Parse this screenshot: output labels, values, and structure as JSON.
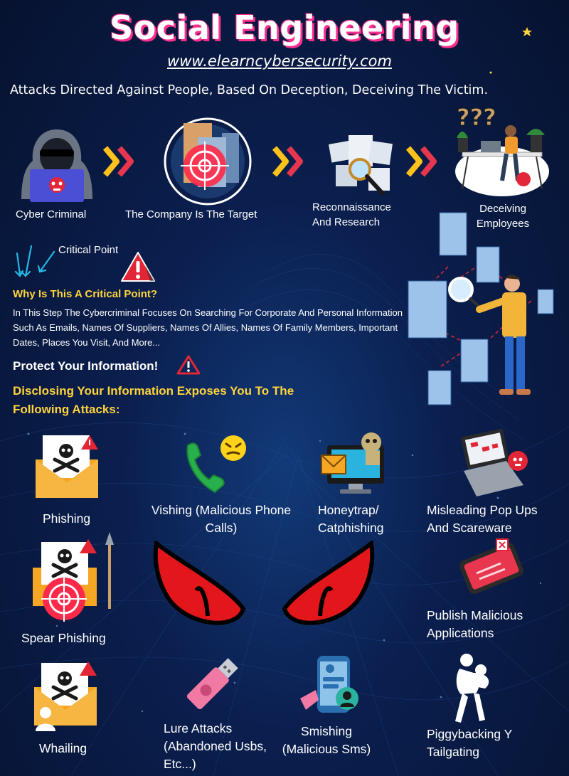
{
  "header": {
    "title": "Social Engineering",
    "url": "www.elearncybersecurity.com",
    "subtitle": "Attacks Directed Against People, Based On Deception, Deceiving The Victim."
  },
  "flow": {
    "steps": [
      {
        "label": "Cyber Criminal",
        "icon": "hooded-hacker-icon"
      },
      {
        "label": "The Company Is The Target",
        "icon": "target-building-icon"
      },
      {
        "label": "Reconnaissance And Research",
        "icon": "magnifier-documents-icon"
      },
      {
        "label": "Deceiving Employees",
        "icon": "confused-employee-icon"
      }
    ],
    "arrow_icon": "double-chevron-icon"
  },
  "critical": {
    "label": "Critical Point",
    "heading": "Why Is This A Critical Point?",
    "body": "In This Step The Cybercriminal Focuses On Searching For Corporate And Personal Information Such As Emails, Names Of Suppliers, Names Of Allies, Names Of Family Members, Important Dates, Places You Visit, And More...",
    "protect": "Protect Your Information!",
    "disclosing": "Disclosing Your Information Exposes You To The Following Attacks:"
  },
  "attacks": {
    "phishing": "Phishing",
    "vishing": "Vishing (Malicious Phone Calls)",
    "honeytrap": "Honeytrap/ Catphishing",
    "popups": "Misleading Pop Ups And Scareware",
    "spear": "Spear Phishing",
    "apps": "Publish Malicious Applications",
    "whaling": "Whailing",
    "lure": "Lure Attacks (Abandoned Usbs, Etc...)",
    "smishing": "Smishing (Malicious Sms)",
    "piggyback": "Piggybacking Y Tailgating"
  },
  "colors": {
    "background": "#0b1f4f",
    "title_glow": "#ff2f8e",
    "heading_yellow": "#ffd43b",
    "chevron_yellow": "#ffc21a",
    "chevron_red": "#e8364f",
    "warning_red": "#e32636",
    "eye_red": "#e3161b"
  }
}
